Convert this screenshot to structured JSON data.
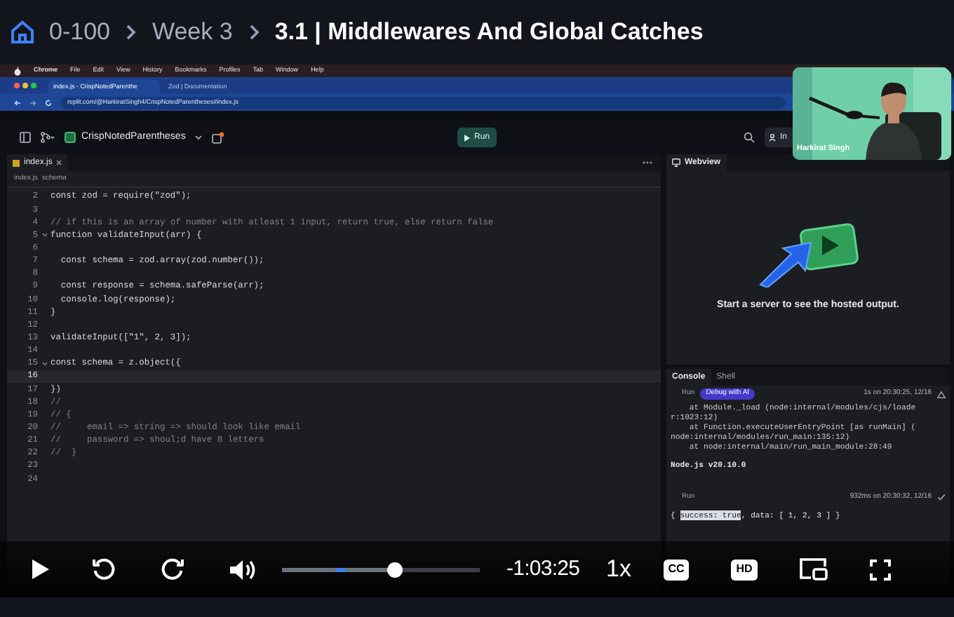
{
  "breadcrumb": [
    {
      "label": "0-100",
      "current": false
    },
    {
      "label": "Week 3",
      "current": false
    },
    {
      "label": "3.1 | Middlewares And Global Catches",
      "current": true
    }
  ],
  "video": {
    "mac_menu": [
      "Chrome",
      "File",
      "Edit",
      "View",
      "History",
      "Bookmarks",
      "Profiles",
      "Tab",
      "Window",
      "Help"
    ],
    "browser_tabs": [
      {
        "label": "index.js - CrispNotedParenthe",
        "selected": true
      },
      {
        "label": "Zod | Documentation",
        "selected": false
      }
    ],
    "url": "replit.com/@HarkiratSingh4/CrispNotedParentheses#index.js",
    "repl_name": "CrispNotedParentheses",
    "run_button": "Run",
    "invite_button": "In",
    "editor_tab": "index.js",
    "editor_path": [
      "index.js",
      "schema"
    ],
    "code_lines": [
      {
        "number": "2",
        "kind": "code",
        "text": "const zod = require(\"zod\");",
        "current": false,
        "foldable": false
      },
      {
        "number": "3",
        "kind": "code",
        "current": false,
        "foldable": false
      },
      {
        "number": "4",
        "kind": "comment",
        "text": "// if this is an array of number with atleast 1 input, return true, else return false",
        "current": false,
        "foldable": false
      },
      {
        "number": "5",
        "kind": "code",
        "text": "function validateInput(arr) {",
        "current": false,
        "foldable": true
      },
      {
        "number": "6",
        "kind": "code",
        "current": false,
        "foldable": false
      },
      {
        "number": "7",
        "kind": "code",
        "text": "  const schema = zod.array(zod.number());",
        "current": false,
        "foldable": false
      },
      {
        "number": "8",
        "kind": "code",
        "current": false,
        "foldable": false
      },
      {
        "number": "9",
        "kind": "code",
        "text": "  const response = schema.safeParse(arr);",
        "current": false,
        "foldable": false
      },
      {
        "number": "10",
        "kind": "code",
        "text": "  console.log(response);",
        "current": false,
        "foldable": false
      },
      {
        "number": "11",
        "kind": "code",
        "text": "}",
        "current": false,
        "foldable": false
      },
      {
        "number": "12",
        "kind": "code",
        "current": false,
        "foldable": false
      },
      {
        "number": "13",
        "kind": "code",
        "text": "validateInput([\"1\", 2, 3]);",
        "current": false,
        "foldable": false
      },
      {
        "number": "14",
        "kind": "code",
        "current": false,
        "foldable": false
      },
      {
        "number": "15",
        "kind": "code",
        "text": "const schema = z.object({",
        "current": false,
        "foldable": true
      },
      {
        "number": "16",
        "kind": "code",
        "current": true,
        "foldable": false
      },
      {
        "number": "17",
        "kind": "code",
        "text": "})",
        "current": false,
        "foldable": false
      },
      {
        "number": "18",
        "kind": "comment",
        "text": "//",
        "current": false,
        "foldable": false
      },
      {
        "number": "19",
        "kind": "comment",
        "text": "// {",
        "current": false,
        "foldable": false
      },
      {
        "number": "20",
        "kind": "comment",
        "text": "//     email => string => should look like email",
        "current": false,
        "foldable": false
      },
      {
        "number": "21",
        "kind": "comment",
        "text": "//     password => shoul;d have 8 letters",
        "current": false,
        "foldable": false
      },
      {
        "number": "22",
        "kind": "comment",
        "text": "//  }",
        "current": false,
        "foldable": false
      },
      {
        "number": "23",
        "kind": "code",
        "current": false,
        "foldable": false
      },
      {
        "number": "24",
        "kind": "code",
        "current": false,
        "foldable": false
      }
    ],
    "webview": {
      "tab": "Webview",
      "message": "Start a server to see the hosted output."
    },
    "console_tabs": [
      {
        "label": "Console",
        "selected": true
      },
      {
        "label": "Shell",
        "selected": false
      }
    ],
    "runs": [
      {
        "label": "Run",
        "kind": "warning",
        "debug_button": "Debug with AI",
        "time": "1s on 20:30:25, 12/16",
        "output": [
          "    at Module._load (node:internal/modules/cjs/loade",
          "r:1023:12)",
          "    at Function.executeUserEntryPoint [as runMain] (",
          "node:internal/modules/run_main:135:12)",
          "    at node:internal/main/run_main_module:28:49"
        ],
        "footer": "Node.js v20.10.0"
      },
      {
        "label": "Run",
        "kind": "success",
        "time": "932ms on 20:30:32, 12/16",
        "result": [
          {
            "text": "{ ",
            "highlighted": false
          },
          {
            "text": "success: true",
            "highlighted": true
          },
          {
            "text": ", data: [ 1, 2, 3 ] }",
            "highlighted": false
          }
        ]
      }
    ],
    "webcam": {
      "name": "Harkirat Singh"
    }
  },
  "player": {
    "progress": {
      "level": 0.57
    },
    "time": "-1:03:25",
    "speed": "1x",
    "captions": "CC",
    "quality": "HD"
  }
}
